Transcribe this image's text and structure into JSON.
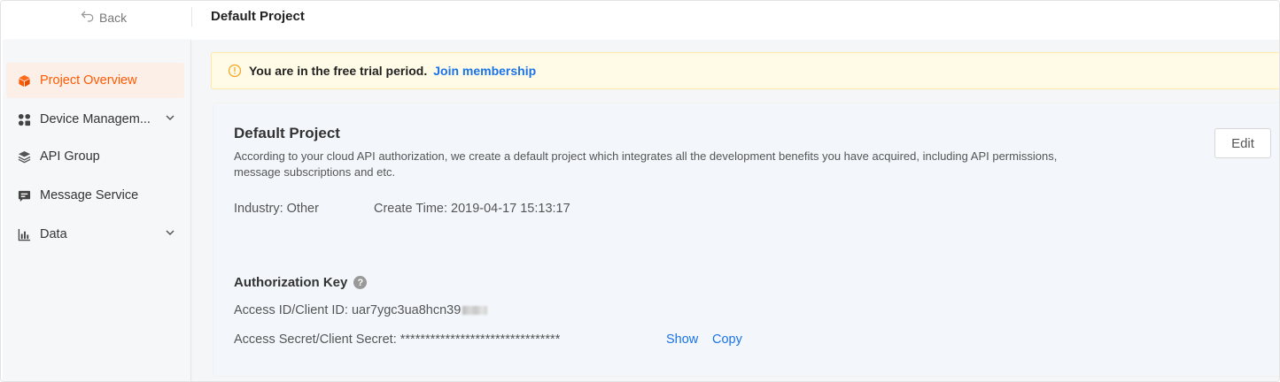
{
  "topbar": {
    "back_label": "Back",
    "title": "Default Project"
  },
  "sidebar": {
    "items": [
      {
        "label": "Project Overview",
        "icon": "cube-icon",
        "active": true
      },
      {
        "label": "Device Managem...",
        "icon": "grid-icon",
        "expandable": true
      },
      {
        "label": "API Group",
        "icon": "layers-icon"
      },
      {
        "label": "Message Service",
        "icon": "message-icon"
      },
      {
        "label": "Data",
        "icon": "bar-chart-icon",
        "expandable": true
      }
    ]
  },
  "notice": {
    "text": "You are in the free trial period.",
    "link": "Join membership",
    "icon": "warning-icon"
  },
  "project": {
    "name": "Default Project",
    "description": "According to your cloud API authorization, we create a default project which integrates all the development benefits you have acquired, including API permissions, message subscriptions and etc.",
    "industry": "Industry: Other",
    "create_time": "Create Time: 2019-04-17 15:13:17",
    "edit_label": "Edit"
  },
  "auth": {
    "title": "Authorization Key",
    "access_id_label": "Access ID/Client ID: ",
    "access_id_value": "uar7ygc3ua8hcn39",
    "secret_label": "Access Secret/Client Secret: ",
    "secret_value": "********************************",
    "show_label": "Show",
    "copy_label": "Copy"
  },
  "colors": {
    "accent": "#ff5a00",
    "link": "#1a73e8",
    "notice_bg": "#fffbe6"
  }
}
